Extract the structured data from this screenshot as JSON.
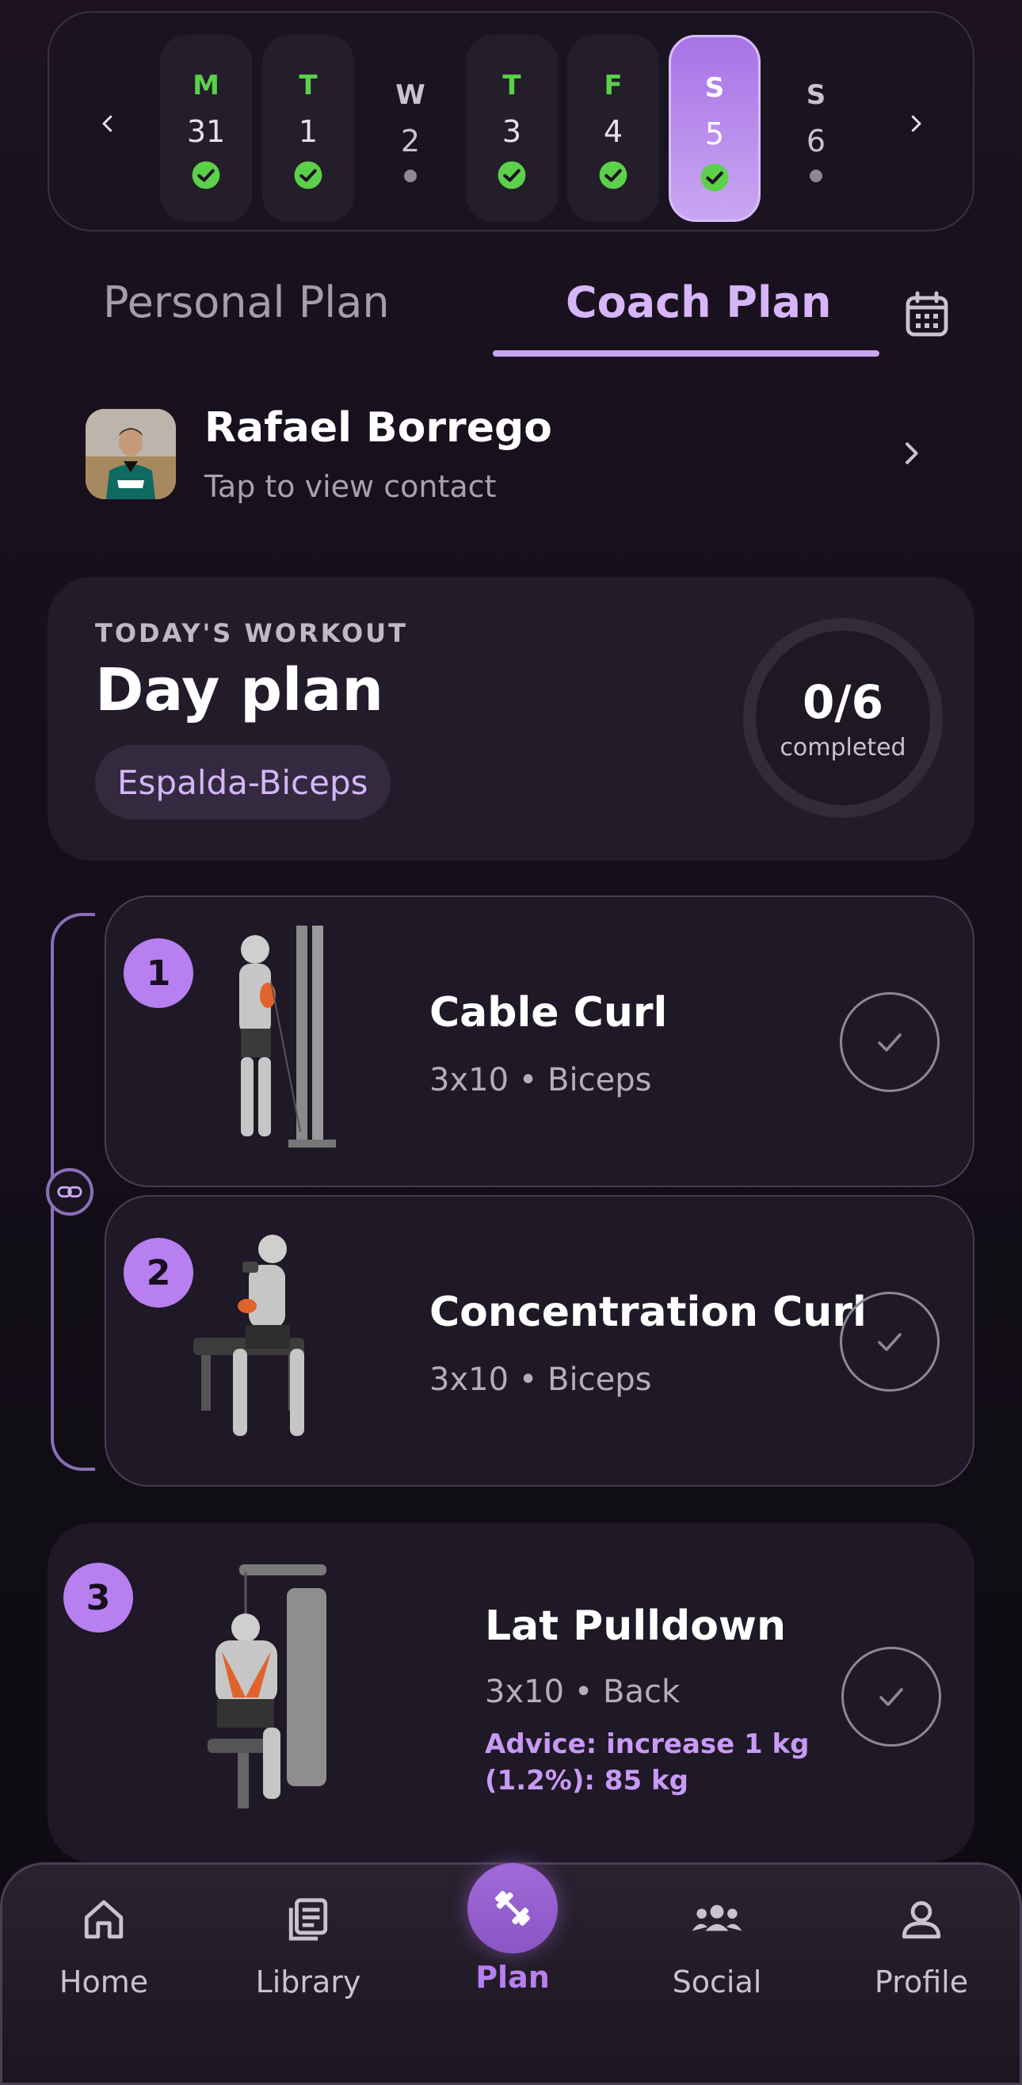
{
  "colors": {
    "accent": "#b77ff0",
    "accent_light": "#d6b5f8",
    "done_green": "#5bd04a",
    "background": "#150f1a"
  },
  "week": {
    "prev_icon": "chevron-left-icon",
    "next_icon": "chevron-right-icon",
    "days": [
      {
        "letter": "M",
        "number": "31",
        "status": "done"
      },
      {
        "letter": "T",
        "number": "1",
        "status": "done"
      },
      {
        "letter": "W",
        "number": "2",
        "status": "rest"
      },
      {
        "letter": "T",
        "number": "3",
        "status": "done"
      },
      {
        "letter": "F",
        "number": "4",
        "status": "done"
      },
      {
        "letter": "S",
        "number": "5",
        "status": "selected"
      },
      {
        "letter": "S",
        "number": "6",
        "status": "rest"
      }
    ]
  },
  "tabs": {
    "personal": "Personal Plan",
    "coach": "Coach Plan",
    "active": "coach",
    "calendar_icon": "calendar-icon"
  },
  "coach": {
    "name": "Rafael Borrego",
    "subtitle": "Tap to view contact"
  },
  "today": {
    "label": "TODAY'S WORKOUT",
    "title": "Day plan",
    "tag": "Espalda-Biceps",
    "completed_count": "0/6",
    "completed_label": "completed",
    "progress": 0
  },
  "exercises": [
    {
      "number": "1",
      "name": "Cable Curl",
      "meta": "3x10 • Biceps",
      "advice": ""
    },
    {
      "number": "2",
      "name": "Concentration Curl",
      "meta": "3x10 • Biceps",
      "advice": ""
    },
    {
      "number": "3",
      "name": "Lat Pulldown",
      "meta": "3x10 • Back",
      "advice_line1": "Advice: increase 1 kg",
      "advice_line2": "(1.2%): 85 kg"
    }
  ],
  "nav": {
    "home": "Home",
    "library": "Library",
    "plan": "Plan",
    "social": "Social",
    "profile": "Profile",
    "active": "plan"
  }
}
